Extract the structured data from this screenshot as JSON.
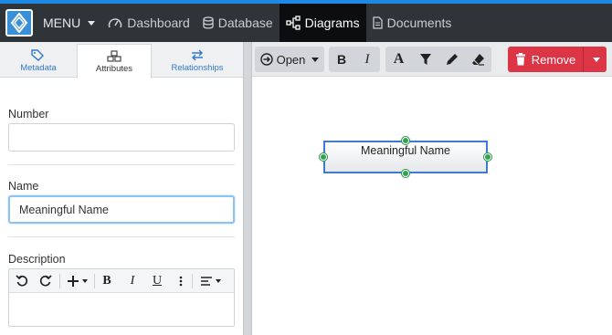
{
  "nav": {
    "menu_label": "MENU",
    "items": [
      {
        "label": "Dashboard",
        "icon": "dashboard-gauge-icon"
      },
      {
        "label": "Database",
        "icon": "database-icon"
      },
      {
        "label": "Diagrams",
        "icon": "diagram-icon",
        "active": true
      },
      {
        "label": "Documents",
        "icon": "document-icon"
      }
    ]
  },
  "left": {
    "tabs": [
      {
        "label": "Metadata",
        "icon": "tags-icon"
      },
      {
        "label": "Attributes",
        "icon": "cubes-icon",
        "active": true
      },
      {
        "label": "Relationships",
        "icon": "exchange-arrows-icon"
      }
    ],
    "number": {
      "label": "Number",
      "value": ""
    },
    "name": {
      "label": "Name",
      "value": "Meaningful Name"
    },
    "description": {
      "label": "Description",
      "toolbar": [
        "undo-icon",
        "redo-icon",
        "insert-plus-icon",
        "bold-icon",
        "italic-icon",
        "underline-icon",
        "more-vertical-icon",
        "align-icon"
      ],
      "bold": "B",
      "italic": "I",
      "underline": "U"
    }
  },
  "toolbar": {
    "open_label": "Open",
    "bold": "B",
    "italic": "I",
    "font": "A",
    "remove_label": "Remove",
    "accent_remove": "#dc3545"
  },
  "canvas": {
    "entity_label": "Meaningful Name",
    "entity_border": "#3f7bd0",
    "handle_color": "#2ea44f"
  }
}
